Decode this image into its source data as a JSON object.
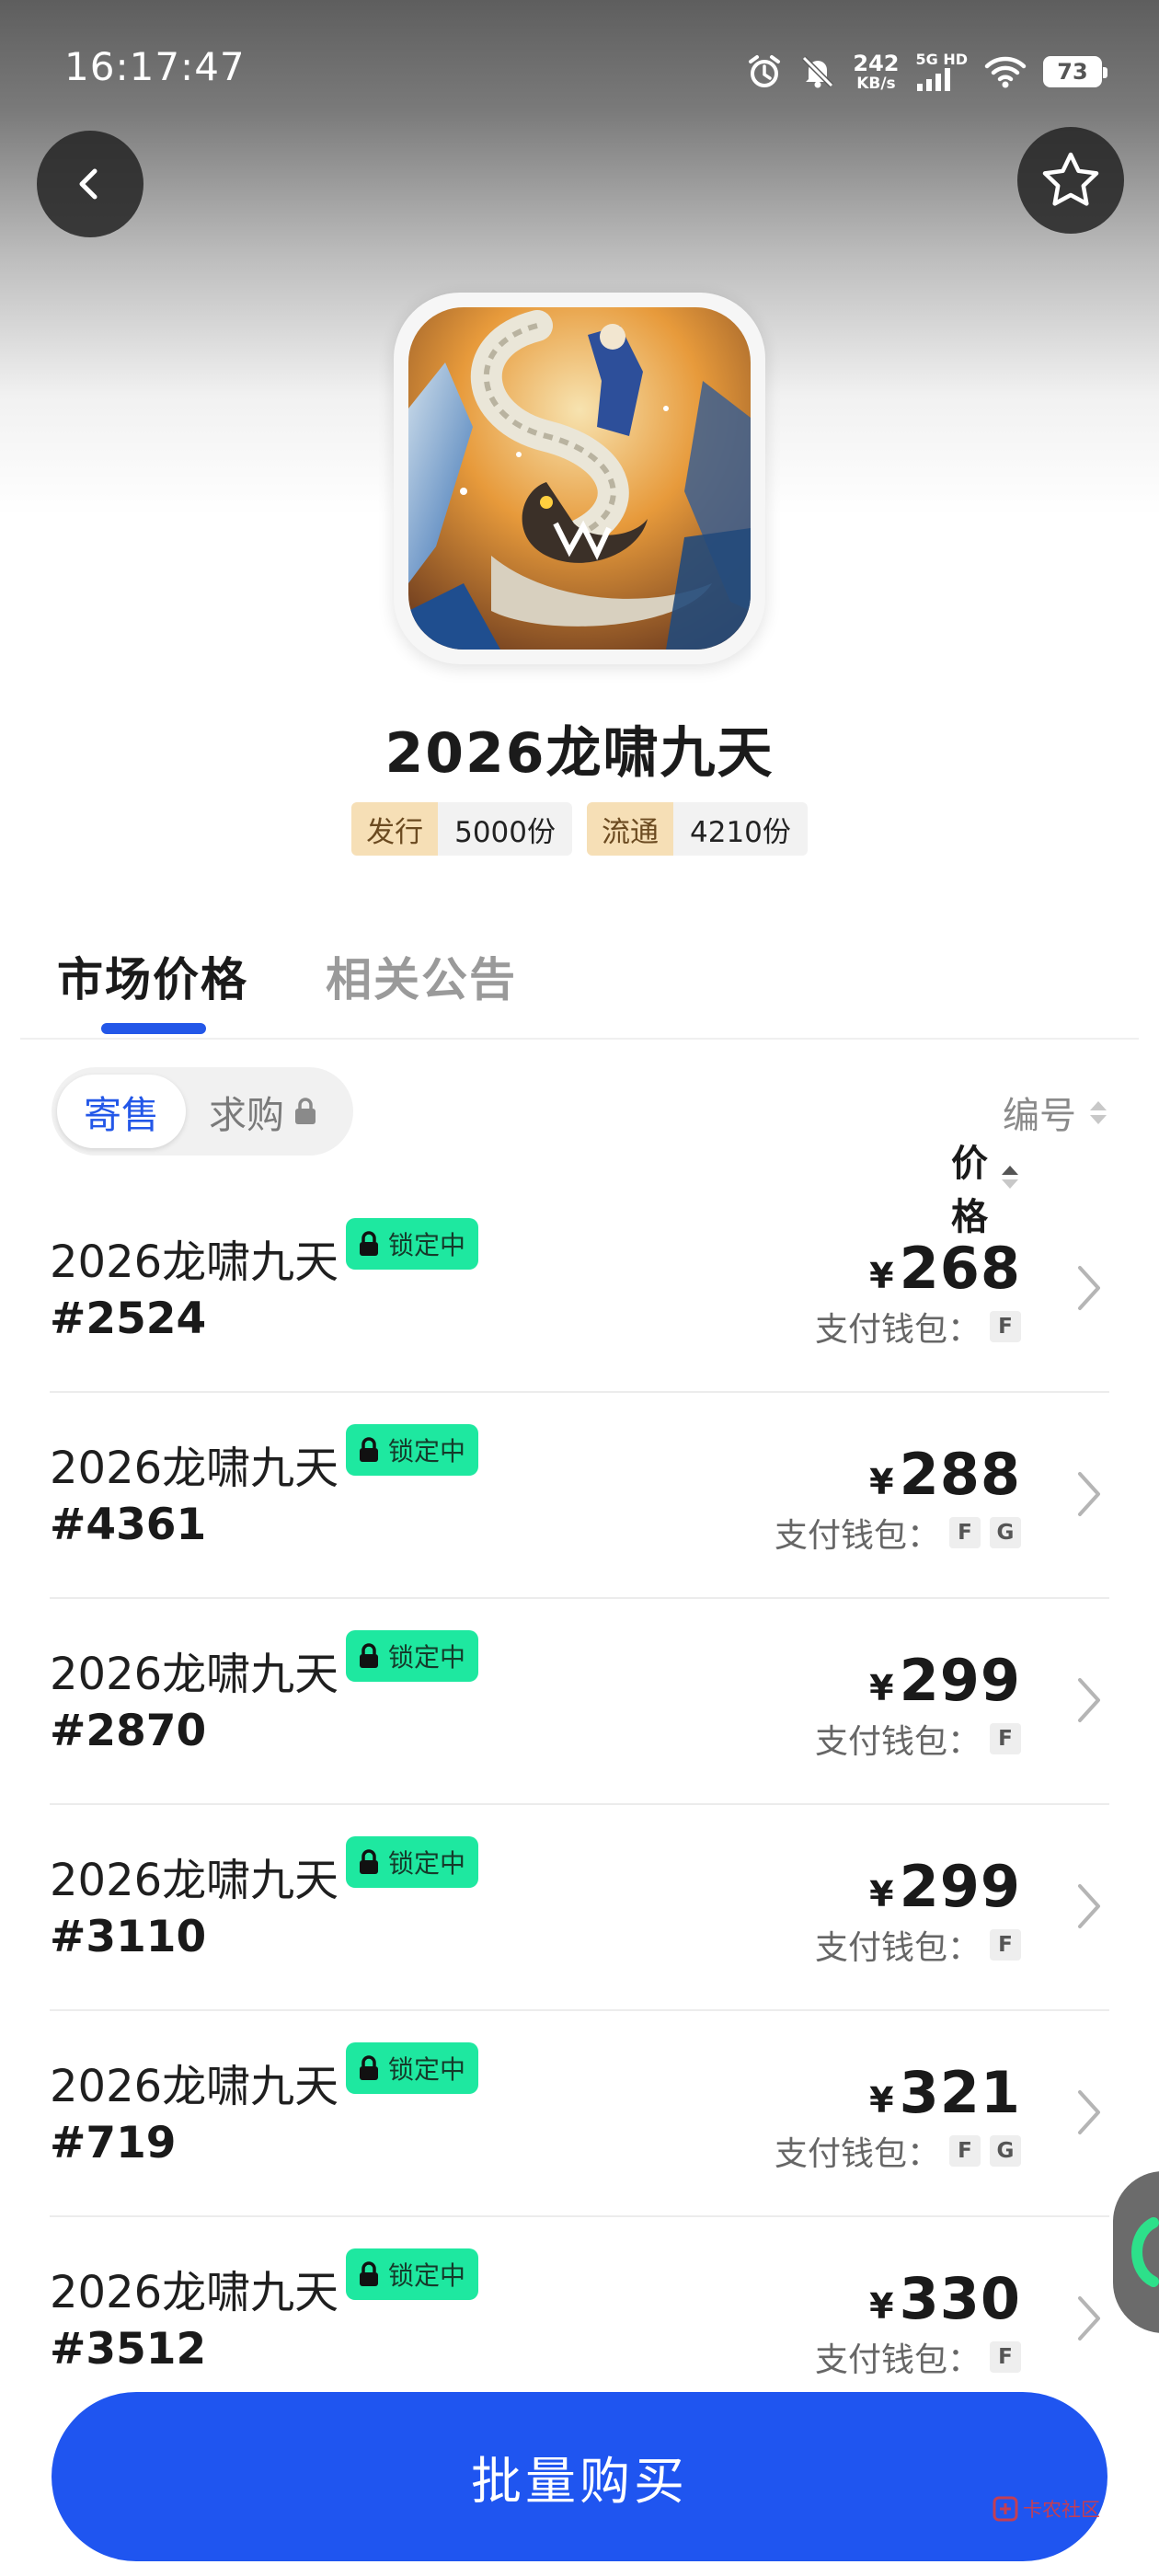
{
  "status_bar": {
    "time": "16:17:47",
    "net_speed_value": "242",
    "net_speed_unit": "KB/s",
    "network_label": "5G HD",
    "battery": "73"
  },
  "product": {
    "title": "2026龙啸九天",
    "stats": [
      {
        "label": "发行",
        "value": "5000份"
      },
      {
        "label": "流通",
        "value": "4210份"
      }
    ]
  },
  "tabs": [
    {
      "label": "市场价格",
      "active": true
    },
    {
      "label": "相关公告",
      "active": false
    }
  ],
  "segment": {
    "consign": "寄售",
    "want_buy": "求购"
  },
  "sort": {
    "price": "价格",
    "number": "编号"
  },
  "listings": [
    {
      "name": "2026龙啸九天",
      "badge": "锁定中",
      "serial": "#2524",
      "currency": "¥",
      "price": "268",
      "wallet_label": "支付钱包：",
      "wallets": [
        "F"
      ]
    },
    {
      "name": "2026龙啸九天",
      "badge": "锁定中",
      "serial": "#4361",
      "currency": "¥",
      "price": "288",
      "wallet_label": "支付钱包：",
      "wallets": [
        "F",
        "G"
      ]
    },
    {
      "name": "2026龙啸九天",
      "badge": "锁定中",
      "serial": "#2870",
      "currency": "¥",
      "price": "299",
      "wallet_label": "支付钱包：",
      "wallets": [
        "F"
      ]
    },
    {
      "name": "2026龙啸九天",
      "badge": "锁定中",
      "serial": "#3110",
      "currency": "¥",
      "price": "299",
      "wallet_label": "支付钱包：",
      "wallets": [
        "F"
      ]
    },
    {
      "name": "2026龙啸九天",
      "badge": "锁定中",
      "serial": "#719",
      "currency": "¥",
      "price": "321",
      "wallet_label": "支付钱包：",
      "wallets": [
        "F",
        "G"
      ]
    },
    {
      "name": "2026龙啸九天",
      "badge": "锁定中",
      "serial": "#3512",
      "currency": "¥",
      "price": "330",
      "wallet_label": "支付钱包：",
      "wallets": [
        "F"
      ]
    }
  ],
  "bulk_buy_label": "批量购买",
  "watermark": "卡农社区",
  "colors": {
    "accent": "#1f55f0",
    "lock_badge": "#1ee8a0",
    "stat_label_bg": "#f6dfb6"
  }
}
